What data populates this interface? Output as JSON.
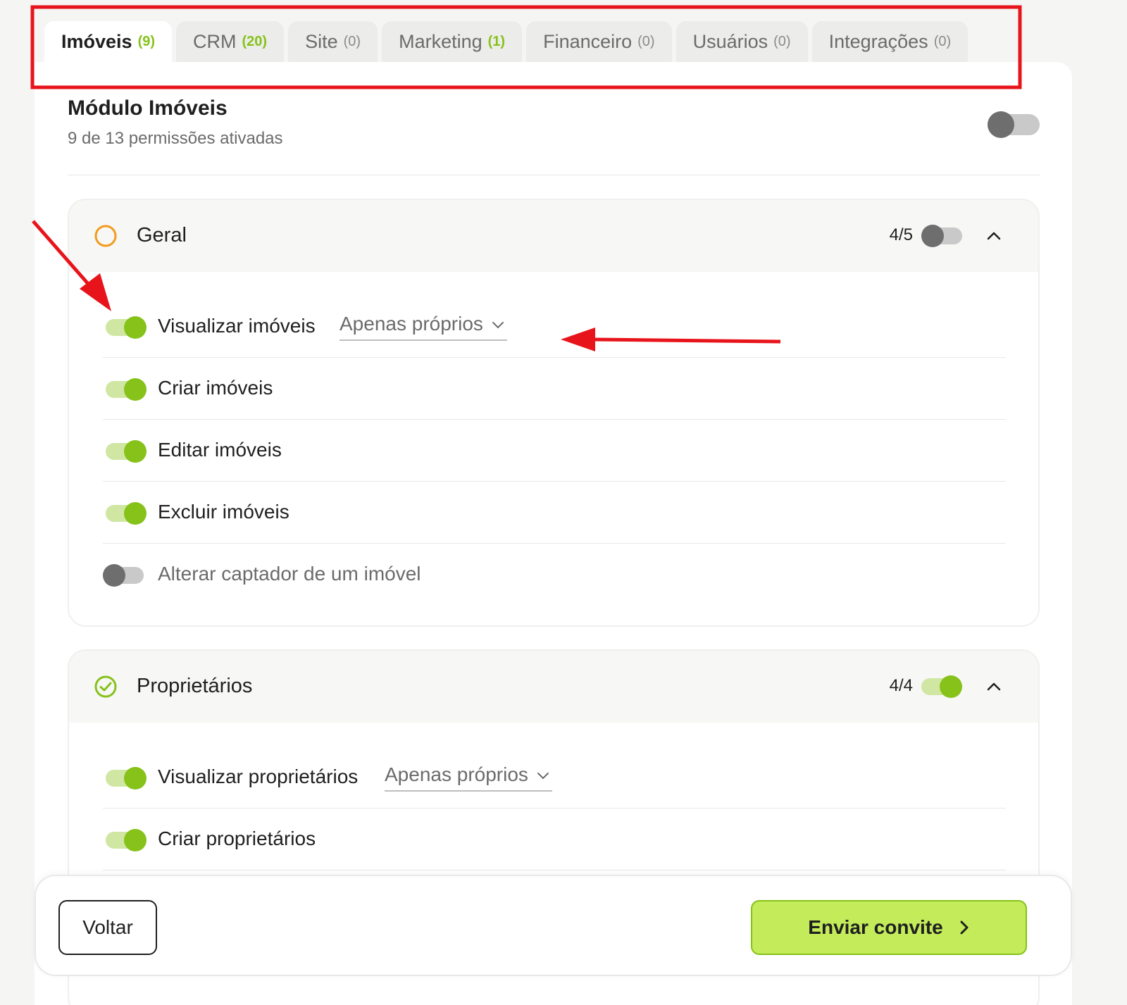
{
  "tabs": [
    {
      "label": "Imóveis",
      "count": "(9)"
    },
    {
      "label": "CRM",
      "count": "(20)"
    },
    {
      "label": "Site",
      "count": "(0)"
    },
    {
      "label": "Marketing",
      "count": "(1)"
    },
    {
      "label": "Financeiro",
      "count": "(0)"
    },
    {
      "label": "Usuários",
      "count": "(0)"
    },
    {
      "label": "Integrações",
      "count": "(0)"
    }
  ],
  "module": {
    "title": "Módulo Imóveis",
    "subtitle": "9 de 13 permissões ativadas",
    "toggle_on": false
  },
  "sections": [
    {
      "title": "Geral",
      "count": "4/5",
      "status": "partial",
      "toggle_on": false,
      "permissions": [
        {
          "label": "Visualizar imóveis",
          "on": true,
          "scope": "Apenas próprios"
        },
        {
          "label": "Criar imóveis",
          "on": true
        },
        {
          "label": "Editar imóveis",
          "on": true
        },
        {
          "label": "Excluir imóveis",
          "on": true
        },
        {
          "label": "Alterar captador de um imóvel",
          "on": false
        }
      ]
    },
    {
      "title": "Proprietários",
      "count": "4/4",
      "status": "complete",
      "toggle_on": true,
      "permissions": [
        {
          "label": "Visualizar proprietários",
          "on": true,
          "scope": "Apenas próprios"
        },
        {
          "label": "Criar proprietários",
          "on": true
        }
      ]
    }
  ],
  "footer": {
    "back_label": "Voltar",
    "send_label": "Enviar convite"
  },
  "colors": {
    "accent": "#86c21a",
    "accent_light": "#c3eb5a",
    "partial": "#f29b1d",
    "annotation": "#e8141b"
  },
  "icons": {
    "partial_status": "circle-outline-icon",
    "complete_status": "check-circle-icon",
    "collapse": "chevron-up-icon",
    "dropdown": "chevron-down-icon",
    "send": "chevron-right-icon"
  }
}
